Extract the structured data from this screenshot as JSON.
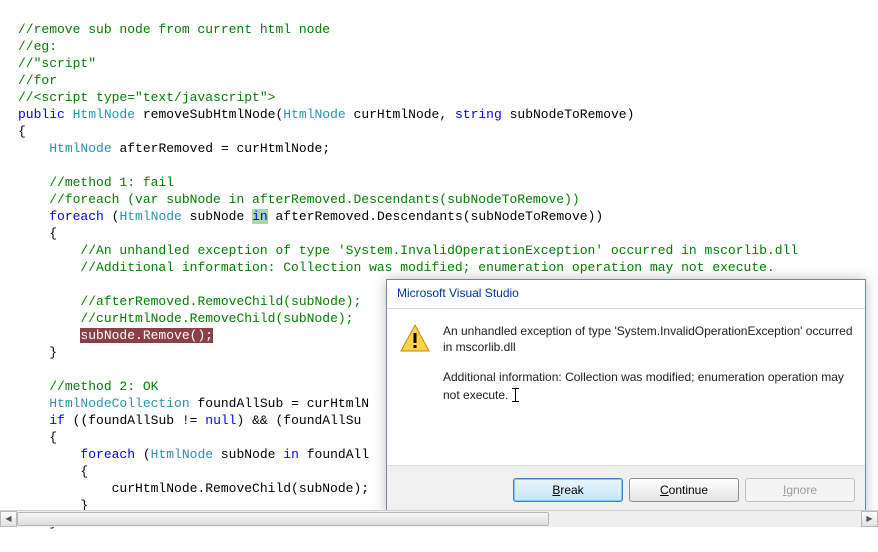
{
  "code": {
    "c1": "//remove sub node from current html node",
    "c2": "//eg:",
    "c3": "//\"script\"",
    "c4": "//for",
    "c5": "//<script type=\"text/javascript\">",
    "kw_public": "public",
    "type_HtmlNode": "HtmlNode",
    "fn_name": "removeSubHtmlNode",
    "param_curHtmlNode": "curHtmlNode",
    "kw_string": "string",
    "param_subNodeToRemove": "subNodeToRemove",
    "var_afterRemoved": "afterRemoved",
    "m1_c1": "//method 1: fail",
    "m1_c2": "//foreach (var subNode in afterRemoved.Descendants(subNodeToRemove))",
    "kw_foreach": "foreach",
    "var_subNode": "subNode",
    "kw_in": "in",
    "call_Descendants": ".Descendants(subNodeToRemove))",
    "inner_c1": "//An unhandled exception of type 'System.InvalidOperationException' occurred in mscorlib.dll",
    "inner_c2": "//Additional information: Collection was modified; enumeration operation may not execute.",
    "inner_c3": "//afterRemoved.RemoveChild(subNode);",
    "inner_c4": "//curHtmlNode.RemoveChild(subNode);",
    "highlighted": "subNode.Remove();",
    "m2_c1": "//method 2: OK",
    "type_HtmlNodeCollection": "HtmlNodeCollection",
    "var_foundAllSub": "foundAllSub",
    "call_curHtmlN": "curHtmlN",
    "kw_if": "if",
    "cond_part": "((foundAllSub != ",
    "kw_null": "null",
    "cond_part2": ") && (foundAllSu",
    "inner2": "curHtmlNode.RemoveChild(subNode);",
    "kw_in2": "in",
    "foundAll": "foundAll"
  },
  "dialog": {
    "title": "Microsoft Visual Studio",
    "msg1": "An unhandled exception of type 'System.InvalidOperationException' occurred in mscorlib.dll",
    "msg2a": "Additional information: Collection was modified; enumeration operation may not execute.",
    "btn_break_u": "B",
    "btn_break": "reak",
    "btn_continue_u": "C",
    "btn_continue": "ontinue",
    "btn_ignore_u": "I",
    "btn_ignore": "gnore"
  }
}
